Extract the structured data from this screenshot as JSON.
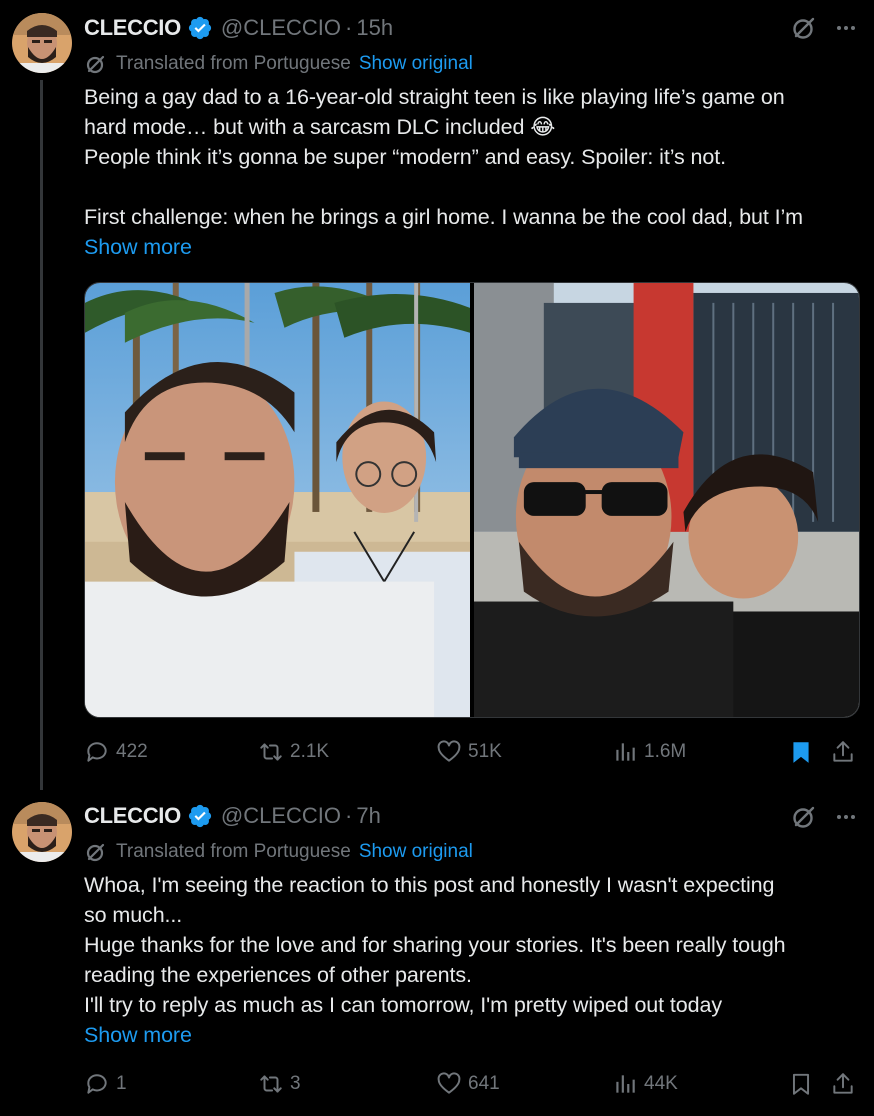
{
  "tweets": [
    {
      "author": {
        "name": "CLECCIO",
        "handle": "@CLECCIO",
        "verified": true
      },
      "time": "15h",
      "translated_label": "Translated from Portuguese",
      "show_original": "Show original",
      "lines": [
        "Being a gay dad to a 16-year-old straight teen is like playing life’s game on",
        "hard mode… but with a sarcasm DLC included 😂",
        "People think it’s gonna be super “modern” and easy. Spoiler: it’s not.",
        "",
        "First challenge: when he brings a girl home. I wanna be the cool dad, but I’m"
      ],
      "show_more": "Show more",
      "media": [
        {
          "icon": "photo-beach-selfie"
        },
        {
          "icon": "photo-city-selfie"
        }
      ],
      "stats": {
        "replies": "422",
        "reposts": "2.1K",
        "likes": "51K",
        "views": "1.6M"
      },
      "bookmarked": true
    },
    {
      "author": {
        "name": "CLECCIO",
        "handle": "@CLECCIO",
        "verified": true
      },
      "time": "7h",
      "translated_label": "Translated from Portuguese",
      "show_original": "Show original",
      "lines": [
        "Whoa, I'm seeing the reaction to this post and honestly I wasn't expecting",
        "so much...",
        "Huge thanks for the love and for sharing your stories. It's been really tough",
        "reading the experiences of other parents.",
        "I'll try to reply as much as I can tomorrow, I'm pretty wiped out today"
      ],
      "show_more": "Show more",
      "stats": {
        "replies": "1",
        "reposts": "3",
        "likes": "641",
        "views": "44K"
      },
      "bookmarked": false
    }
  ],
  "colors": {
    "background": "#000000",
    "text": "#e7e9ea",
    "muted": "#71767b",
    "link": "#1d9bf0",
    "verified": "#1d9bf0",
    "divider": "#333639"
  },
  "separator": "·"
}
